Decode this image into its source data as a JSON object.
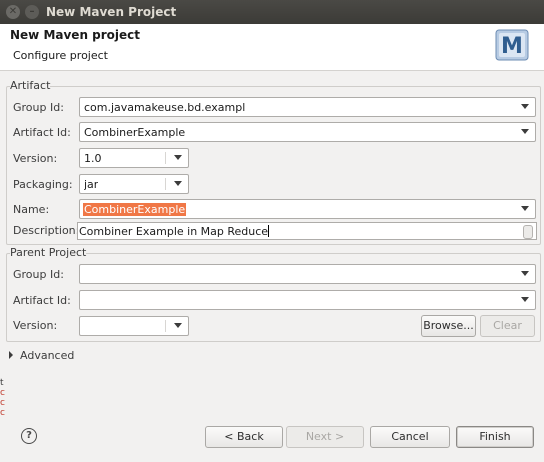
{
  "window": {
    "title": "New Maven Project"
  },
  "header": {
    "title": "New Maven project",
    "subtitle": "Configure project",
    "logo_letter": "M"
  },
  "artifact": {
    "legend": "Artifact",
    "group_id": {
      "label": "Group Id:",
      "value": "com.javamakeuse.bd.exampl"
    },
    "artifact_id": {
      "label": "Artifact Id:",
      "value": "CombinerExample"
    },
    "version": {
      "label": "Version:",
      "value": "1.0"
    },
    "packaging": {
      "label": "Packaging:",
      "value": "jar"
    },
    "name": {
      "label": "Name:",
      "value": "CombinerExample"
    },
    "description": {
      "label": "Description:",
      "value": "Combiner Example in Map Reduce"
    }
  },
  "parent": {
    "legend": "Parent Project",
    "group_id": {
      "label": "Group Id:",
      "value": ""
    },
    "artifact_id": {
      "label": "Artifact Id:",
      "value": ""
    },
    "version": {
      "label": "Version:",
      "value": ""
    },
    "browse_label": "Browse...",
    "clear_label": "Clear"
  },
  "advanced": {
    "label": "Advanced"
  },
  "side_fragment": [
    "t",
    "c",
    "c",
    "c"
  ],
  "footer": {
    "help_glyph": "?",
    "back_label": "< Back",
    "next_label": "Next >",
    "cancel_label": "Cancel",
    "finish_label": "Finish"
  },
  "colors": {
    "selection": "#f07746",
    "titlebar": "#3c3b37",
    "background": "#f2f1f0"
  }
}
